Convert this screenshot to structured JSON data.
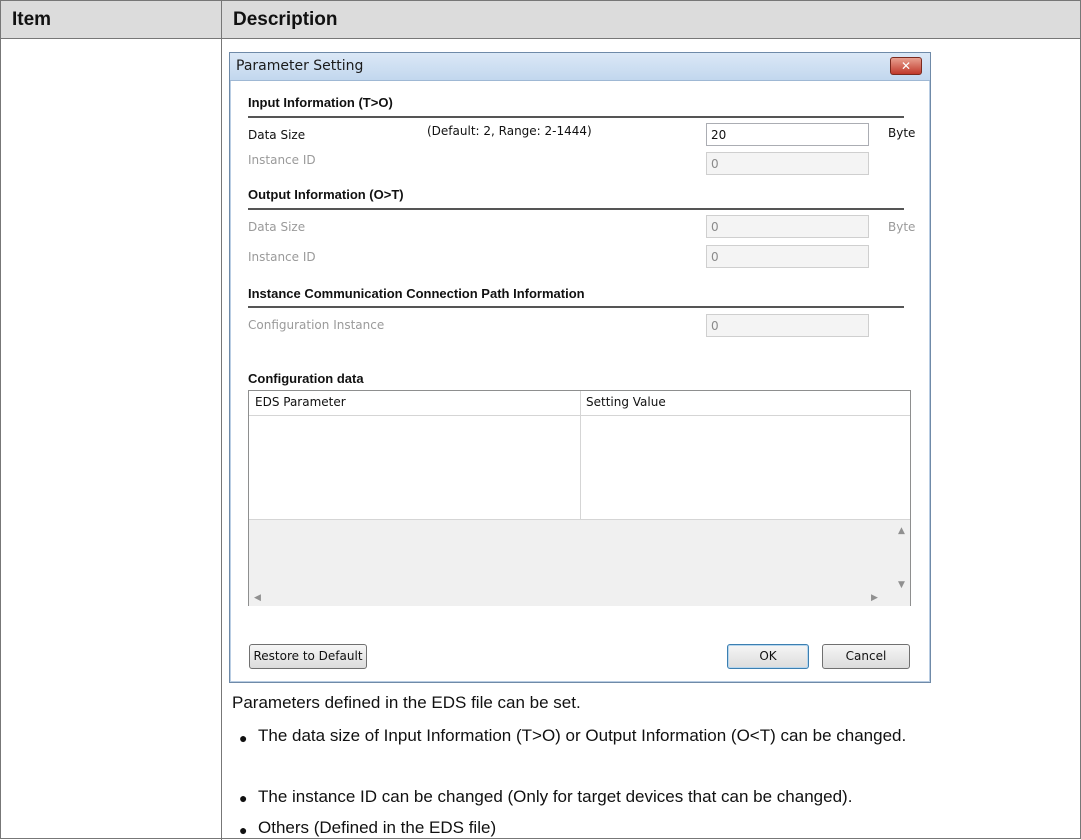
{
  "table": {
    "header_item": "Item",
    "header_description": "Description"
  },
  "dialog": {
    "title": "Parameter Setting",
    "close_glyph": "✕",
    "input_section": {
      "title": "Input Information (T>O)",
      "data_size_label": "Data Size",
      "data_size_hint": "(Default: 2, Range: 2-1444)",
      "data_size_value": "20",
      "data_size_unit": "Byte",
      "instance_id_label": "Instance ID",
      "instance_id_value": "0"
    },
    "output_section": {
      "title": "Output Information (O>T)",
      "data_size_label": "Data Size",
      "data_size_value": "0",
      "data_size_unit": "Byte",
      "instance_id_label": "Instance ID",
      "instance_id_value": "0"
    },
    "connection_section": {
      "title": "Instance Communication Connection Path Information",
      "config_instance_label": "Configuration Instance",
      "config_instance_value": "0"
    },
    "config_data": {
      "title": "Configuration data",
      "columns": [
        "EDS Parameter",
        "Setting Value"
      ],
      "rows": []
    },
    "buttons": {
      "restore": "Restore to Default",
      "ok": "OK",
      "cancel": "Cancel"
    }
  },
  "description": {
    "intro": "Parameters defined in the EDS file can be set.",
    "bullets": [
      "The data size of Input Information (T>O) or Output Information (O<T) can be changed.",
      "The instance ID can be changed (Only for target devices that can be changed).",
      "Others (Defined in the EDS file)"
    ]
  }
}
